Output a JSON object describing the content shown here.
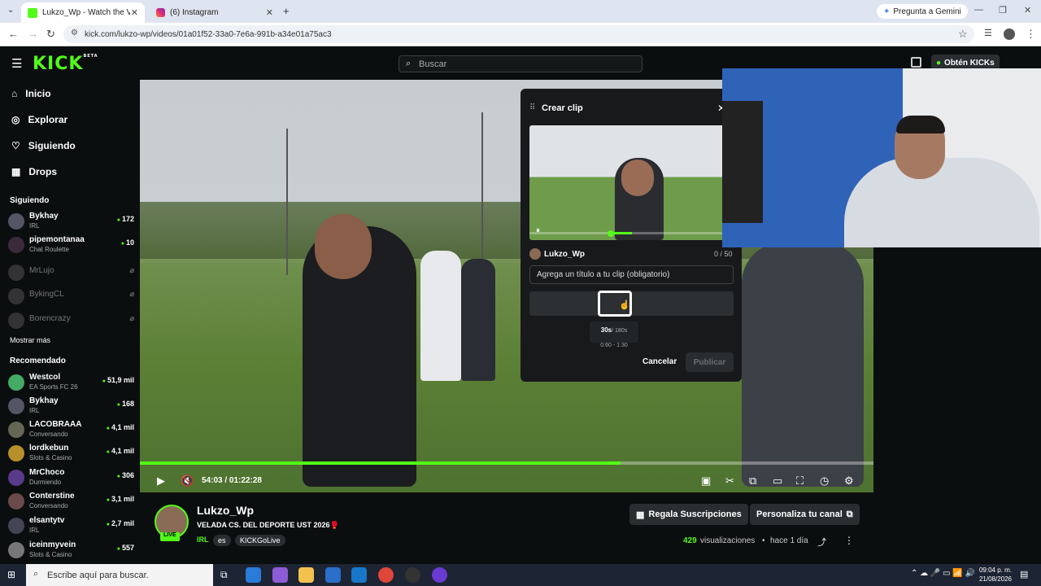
{
  "browser": {
    "tabs": [
      {
        "label": "Lukzo_Wp - Watch the VOD",
        "active": true
      },
      {
        "label": "(6) Instagram",
        "active": false
      }
    ],
    "gemini": "Pregunta a Gemini",
    "url": "kick.com/lukzo-wp/videos/01a01f52-33a0-7e6a-991b-a34e01a75ac3"
  },
  "header": {
    "logo": "KICK",
    "logo_badge": "BETA",
    "search_placeholder": "Buscar",
    "kicks_button": "Obtén KICKs"
  },
  "sidebar": {
    "nav": [
      {
        "label": "Inicio",
        "icon": "home-icon"
      },
      {
        "label": "Explorar",
        "icon": "compass-icon"
      },
      {
        "label": "Siguiendo",
        "icon": "heart-icon"
      },
      {
        "label": "Drops",
        "icon": "drops-icon"
      }
    ],
    "following_title": "Siguiendo",
    "following": [
      {
        "name": "Bykhay",
        "sub": "IRL",
        "viewers": "172",
        "live": true
      },
      {
        "name": "pipemontanaa",
        "sub": "Chat Roulette",
        "viewers": "10",
        "live": true
      },
      {
        "name": "MrLujo",
        "sub": "",
        "viewers": "",
        "live": false
      },
      {
        "name": "BykingCL",
        "sub": "",
        "viewers": "",
        "live": false
      },
      {
        "name": "Borencrazy",
        "sub": "",
        "viewers": "",
        "live": false
      }
    ],
    "show_more": "Mostrar más",
    "recommended_title": "Recomendado",
    "recommended": [
      {
        "name": "Westcol",
        "sub": "EA Sports FC 26",
        "viewers": "51,9 mil"
      },
      {
        "name": "Bykhay",
        "sub": "IRL",
        "viewers": "168"
      },
      {
        "name": "LACOBRAAA",
        "sub": "Conversando",
        "viewers": "4,1 mil"
      },
      {
        "name": "lordkebun",
        "sub": "Slots & Casino",
        "viewers": "4,1 mil"
      },
      {
        "name": "MrChoco",
        "sub": "Durmiendo",
        "viewers": "306"
      },
      {
        "name": "Conterstine",
        "sub": "Conversando",
        "viewers": "3,1 mil"
      },
      {
        "name": "elsantytv",
        "sub": "IRL",
        "viewers": "2,7 mil"
      },
      {
        "name": "iceinmyvein",
        "sub": "Slots & Casino",
        "viewers": "557"
      }
    ]
  },
  "player": {
    "time": "54:03 / 01:22:28",
    "progress": 0.655
  },
  "clip": {
    "title": "Crear clip",
    "channel": "Lukzo_Wp",
    "char_count": "0 / 50",
    "title_placeholder": "Agrega un título a tu clip (obligatorio)",
    "duration": "30s",
    "max_duration": "/ 180s",
    "range": "0:60 - 1:30",
    "cancel": "Cancelar",
    "publish": "Publicar"
  },
  "stream": {
    "channel": "Lukzo_Wp",
    "live_badge": "LIVE",
    "title": "VELADA CS. DEL DEPORTE UST 2026🥊",
    "category": "IRL",
    "tags": [
      "es",
      "KICKGoLive"
    ],
    "gift_button": "Regala Suscripciones",
    "customize_button": "Personaliza tu canal",
    "views_count": "429",
    "views_label": "visualizaciones",
    "age": "hace 1 día"
  },
  "taskbar": {
    "search_placeholder": "Escribe aquí para buscar.",
    "time": "09:04 p. m.",
    "date": "21/08/2026"
  },
  "colors": {
    "accent": "#53fc18",
    "bg": "#0b0e0f"
  }
}
